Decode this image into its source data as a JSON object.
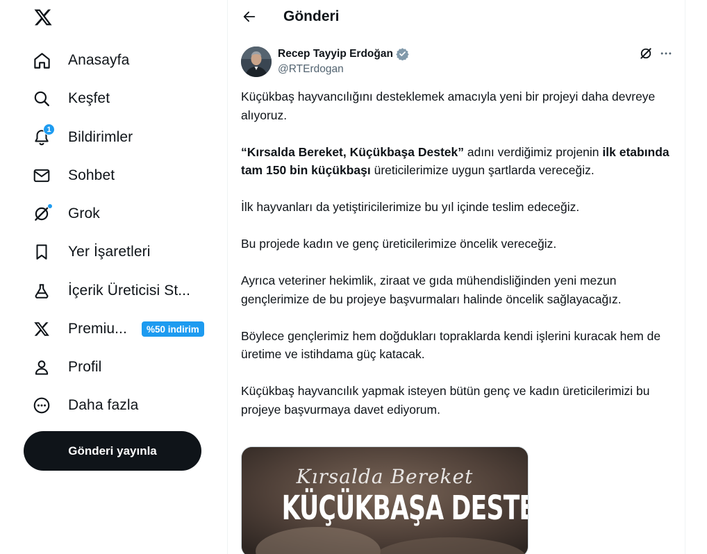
{
  "nav": {
    "items": [
      {
        "label": "Anasayfa"
      },
      {
        "label": "Keşfet"
      },
      {
        "label": "Bildirimler",
        "badge": "1"
      },
      {
        "label": "Sohbet"
      },
      {
        "label": "Grok"
      },
      {
        "label": "Yer İşaretleri"
      },
      {
        "label": "İçerik Üreticisi St..."
      },
      {
        "label": "Premiu...",
        "promo": "%50 indirim"
      },
      {
        "label": "Profil"
      },
      {
        "label": "Daha fazla"
      }
    ],
    "post_button": "Gönderi yayınla"
  },
  "header": {
    "title": "Gönderi"
  },
  "post": {
    "author_name": "Recep Tayyip Erdoğan",
    "handle": "@RTErdogan",
    "p1": "Küçükbaş hayvancılığını desteklemek amacıyla yeni bir projeyi daha devreye alıyoruz.",
    "p2_bold1": "“Kırsalda Bereket, Küçükbaşa Destek”",
    "p2_text1": " adını verdiğimiz projenin ",
    "p2_bold2": "ilk etabında tam 150 bin küçükbaşı",
    "p2_text2": " üreticilerimize uygun şartlarda vereceğiz.",
    "p3": "İlk hayvanları da yetiştiricilerimize bu yıl içinde teslim edeceğiz.",
    "p4": "Bu projede kadın ve genç üreticilerimize öncelik vereceğiz.",
    "p5": "Ayrıca veteriner hekimlik, ziraat ve gıda mühendisliğinden yeni mezun gençlerimize de bu projeye başvurmaları halinde öncelik sağlayacağız.",
    "p6": "Böylece gençlerimiz hem doğdukları topraklarda kendi işlerini kuracak hem de üretime ve istihdama güç katacak.",
    "p7": "Küçükbaş hayvancılık yapmak isteyen bütün genç ve kadın üreticilerimizi bu projeye başvurmaya davet ediyorum.",
    "media": {
      "script_text": "Kırsalda Bereket",
      "title_text": "KÜÇÜKBAŞA DESTEK"
    }
  },
  "colors": {
    "accent": "#1d9bf0",
    "text": "#0f1419",
    "secondary_text": "#536471",
    "post_button_bg": "#0f1419"
  },
  "icons": [
    "x-logo-icon",
    "home-icon",
    "search-icon",
    "bell-icon",
    "envelope-icon",
    "grok-icon",
    "bookmark-icon",
    "creator-studio-icon",
    "x-premium-icon",
    "person-icon",
    "more-circle-icon",
    "back-arrow-icon",
    "verified-badge-icon",
    "grok-icon",
    "more-horizontal-icon"
  ]
}
